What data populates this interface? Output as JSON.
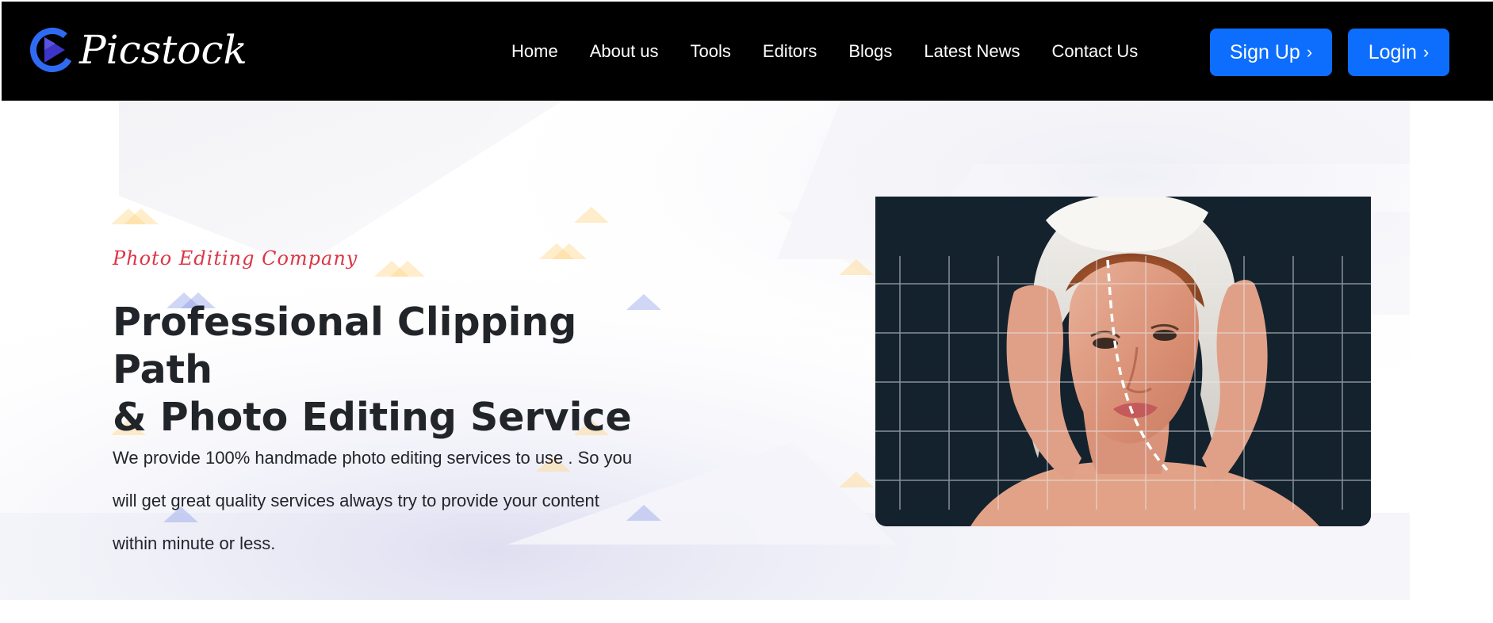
{
  "brand": {
    "name": "Picstock",
    "logo_icon": "play-circle-logo-icon",
    "accent_color": "#0d6efd"
  },
  "nav": {
    "items": [
      {
        "label": "Home"
      },
      {
        "label": "About us"
      },
      {
        "label": "Tools"
      },
      {
        "label": "Editors"
      },
      {
        "label": "Blogs"
      },
      {
        "label": "Latest News"
      },
      {
        "label": "Contact Us"
      }
    ],
    "signup_label": "Sign Up",
    "login_label": "Login",
    "button_chevron": "›"
  },
  "hero": {
    "eyebrow": "Photo Editing Company",
    "title_line1": "Professional Clipping Path",
    "title_line2": "& Photo Editing Service",
    "description": "We provide 100% handmade photo editing services to use . So you will get great quality services always try to provide your content within minute or less.",
    "eyebrow_color": "#dc3545",
    "image_subject": "woman-with-towel-photo"
  }
}
